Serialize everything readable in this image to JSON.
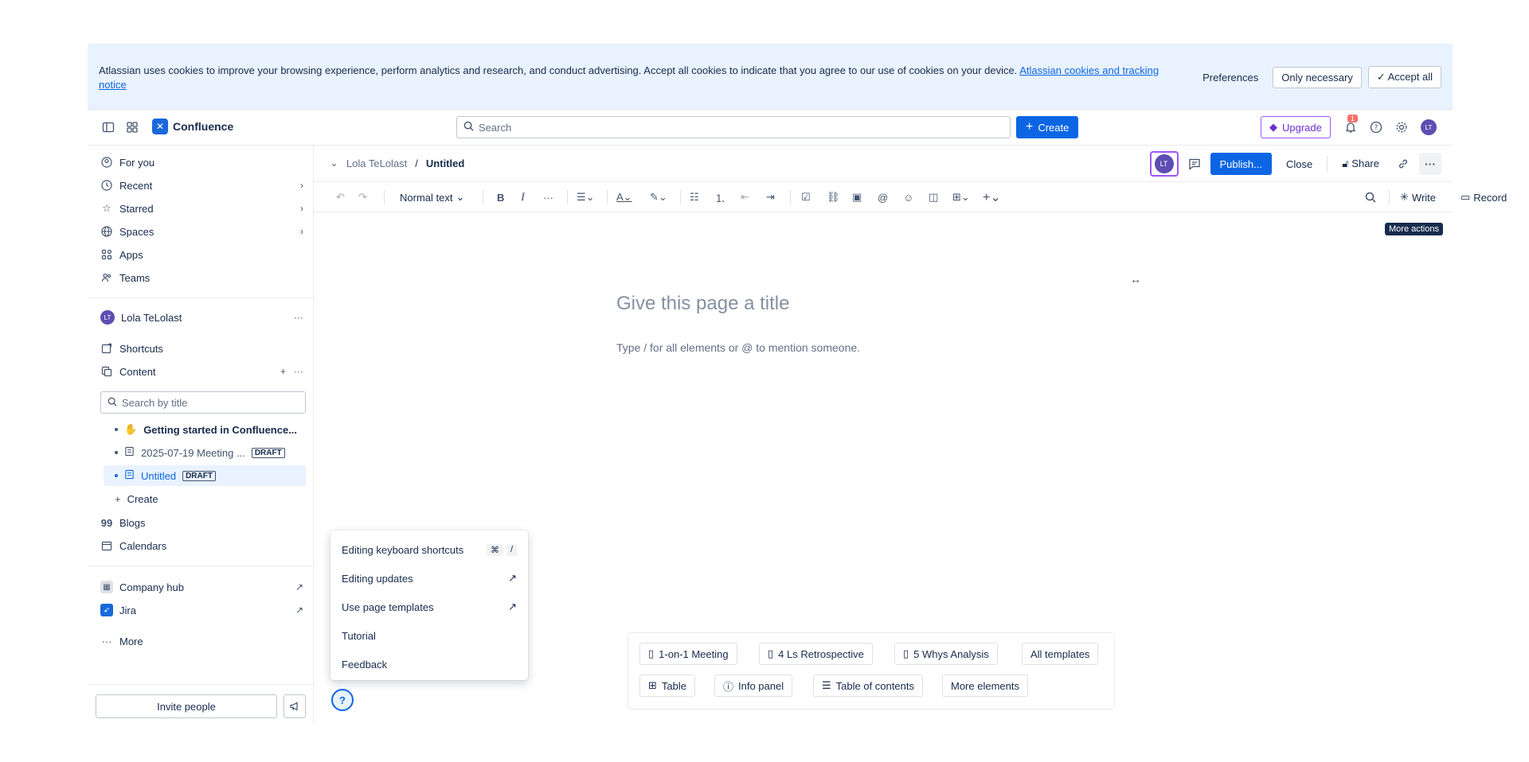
{
  "cookie": {
    "text": "Atlassian uses cookies to improve your browsing experience, perform analytics and research, and conduct advertising. Accept all cookies to indicate that you agree to our use of cookies on your device.",
    "link": "Atlassian cookies and tracking notice",
    "preferences": "Preferences",
    "only_necessary": "Only necessary",
    "accept_all": "Accept all"
  },
  "topnav": {
    "app_name": "Confluence",
    "search_placeholder": "Search",
    "create": "Create",
    "upgrade": "Upgrade",
    "notification_count": "1",
    "avatar_initials": "LT"
  },
  "sidebar": {
    "items": [
      {
        "label": "For you",
        "icon": "user-circle-icon"
      },
      {
        "label": "Recent",
        "icon": "clock-icon"
      },
      {
        "label": "Starred",
        "icon": "star-icon"
      },
      {
        "label": "Spaces",
        "icon": "globe-icon"
      },
      {
        "label": "Apps",
        "icon": "apps-icon"
      },
      {
        "label": "Teams",
        "icon": "people-icon"
      }
    ],
    "space": {
      "initials": "LT",
      "name": "Lola TeLolast"
    },
    "shortcuts": "Shortcuts",
    "content": "Content",
    "tree_search_placeholder": "Search by title",
    "tree": [
      {
        "label": "Getting started in Confluence...",
        "badge": ""
      },
      {
        "label": "2025-07-19 Meeting ...",
        "badge": "DRAFT"
      },
      {
        "label": "Untitled",
        "badge": "DRAFT"
      }
    ],
    "tree_create": "Create",
    "blogs": "Blogs",
    "calendars": "Calendars",
    "company_hub": "Company hub",
    "jira": "Jira",
    "more": "More",
    "invite": "Invite people"
  },
  "pageheader": {
    "breadcrumb_space": "Lola TeLolast",
    "breadcrumb_page": "Untitled",
    "collab_initials": "LT",
    "publish": "Publish...",
    "close": "Close",
    "share": "Share",
    "tooltip": "More actions"
  },
  "toolbar": {
    "text_style": "Normal text",
    "write": "Write",
    "record": "Record"
  },
  "editor": {
    "title_placeholder": "Give this page a title",
    "body_placeholder": "Type / for all elements or @ to mention someone."
  },
  "helpmenu": {
    "items": [
      {
        "label": "Editing keyboard shortcuts"
      },
      {
        "label": "Editing updates"
      },
      {
        "label": "Use page templates"
      },
      {
        "label": "Tutorial"
      },
      {
        "label": "Feedback"
      }
    ],
    "kbd_1": "⌘",
    "kbd_2": "/"
  },
  "templates": {
    "row1": [
      "1-on-1 Meeting",
      "4 Ls Retrospective",
      "5 Whys Analysis",
      "All templates"
    ],
    "row2": [
      "Table",
      "Info panel",
      "Table of contents",
      "More elements"
    ]
  }
}
